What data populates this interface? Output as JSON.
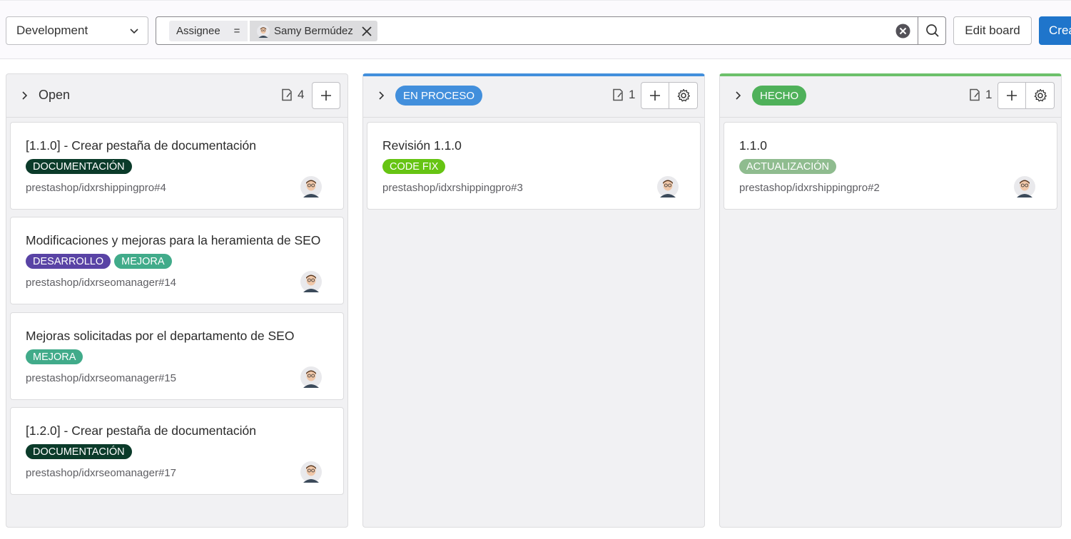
{
  "topbar": {
    "board_name": "Development",
    "filter": {
      "key": "Assignee",
      "operator": "=",
      "value": "Samy Bermúdez"
    },
    "edit_board_label": "Edit board",
    "create_label": "Crea"
  },
  "columns": [
    {
      "title": "Open",
      "is_label": false,
      "count": "4",
      "cards": [
        {
          "title": "[1.1.0] - Crear pestaña de documentación",
          "labels": [
            {
              "text": "DOCUMENTACIÓN",
              "color": "#0b3b2a"
            }
          ],
          "ref": "prestashop/idxrshippingpro#4"
        },
        {
          "title": "Modificaciones y mejoras para la heramienta de SEO",
          "labels": [
            {
              "text": "DESARROLLO",
              "color": "#5943a5"
            },
            {
              "text": "MEJORA",
              "color": "#41ab8a"
            }
          ],
          "ref": "prestashop/idxrseomanager#14"
        },
        {
          "title": "Mejoras solicitadas por el departamento de SEO",
          "labels": [
            {
              "text": "MEJORA",
              "color": "#41ab8a"
            }
          ],
          "ref": "prestashop/idxrseomanager#15"
        },
        {
          "title": "[1.2.0] - Crear pestaña de documentación",
          "labels": [
            {
              "text": "DOCUMENTACIÓN",
              "color": "#0b3b2a"
            }
          ],
          "ref": "prestashop/idxrseomanager#17"
        }
      ]
    },
    {
      "title": "EN PROCESO",
      "is_label": true,
      "label_color": "#428fdc",
      "count": "1",
      "cards": [
        {
          "title": "Revisión 1.1.0",
          "labels": [
            {
              "text": "CODE FIX",
              "color": "#66c413"
            }
          ],
          "ref": "prestashop/idxrshippingpro#3"
        }
      ]
    },
    {
      "title": "HECHO",
      "is_label": true,
      "label_color": "#4fb15a",
      "count": "1",
      "cards": [
        {
          "title": "1.1.0",
          "labels": [
            {
              "text": "ACTUALIZACIÓN",
              "color": "#8fbc8f"
            }
          ],
          "ref": "prestashop/idxrshippingpro#2"
        }
      ]
    }
  ]
}
